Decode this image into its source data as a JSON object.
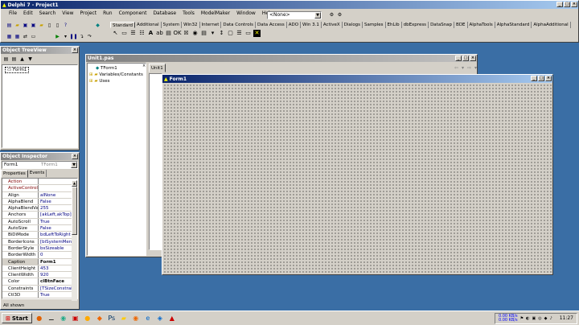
{
  "app": {
    "title": "Delphi 7 - Project1"
  },
  "menu": [
    "File",
    "Edit",
    "Search",
    "View",
    "Project",
    "Run",
    "Component",
    "Database",
    "Tools",
    "ModelMaker",
    "Window",
    "Help"
  ],
  "combo": {
    "value": "<None>"
  },
  "palette_tabs": [
    "Standard",
    "Additional",
    "System",
    "Win32",
    "Internet",
    "Data Controls",
    "Data Access",
    "ADO",
    "Win 3.1",
    "ActiveX",
    "Dialogs",
    "Samples",
    "EhLib",
    "dbExpress",
    "DataSnap",
    "BDE",
    "AlphaTools",
    "AlphaStandard",
    "AlphaAdditional"
  ],
  "treeview": {
    "title": "Object TreeView",
    "item": "Form1"
  },
  "inspector": {
    "title": "Object Inspector",
    "object_name": "Form1",
    "object_type": "TForm1",
    "tabs": [
      "Properties",
      "Events"
    ],
    "rows": [
      {
        "k": "Action",
        "v": ""
      },
      {
        "k": "ActiveControl",
        "v": ""
      },
      {
        "k": "Align",
        "v": "alNone"
      },
      {
        "k": "AlphaBlend",
        "v": "False"
      },
      {
        "k": "AlphaBlendVal",
        "v": "255"
      },
      {
        "k": "Anchors",
        "v": "[akLeft,akTop]"
      },
      {
        "k": "AutoScroll",
        "v": "True"
      },
      {
        "k": "AutoSize",
        "v": "False"
      },
      {
        "k": "BiDiMode",
        "v": "bdLeftToRight"
      },
      {
        "k": "BorderIcons",
        "v": "[biSystemMenu,"
      },
      {
        "k": "BorderStyle",
        "v": "bsSizeable"
      },
      {
        "k": "BorderWidth",
        "v": "0"
      },
      {
        "k": "Caption",
        "v": "Form1"
      },
      {
        "k": "ClientHeight",
        "v": "453"
      },
      {
        "k": "ClientWidth",
        "v": "920"
      },
      {
        "k": "Color",
        "v": "clBtnFace"
      },
      {
        "k": "Constraints",
        "v": "[TSizeConstraint"
      },
      {
        "k": "Ctl3D",
        "v": "True"
      }
    ],
    "status": "All shown"
  },
  "editor": {
    "title": "Unit1.pas",
    "tab": "Unit1",
    "tree": [
      "TForm1",
      "Variables/Constants",
      "Uses"
    ]
  },
  "form": {
    "title": "Form1"
  },
  "taskbar": {
    "start": "Start",
    "time": "11:27",
    "net1": "0.00 KB/s",
    "net2": "0.00 KB/s"
  },
  "colors": {
    "desktop": "#3a6ea5",
    "titlebar": "#0a246a",
    "face": "#d4d0c8"
  }
}
